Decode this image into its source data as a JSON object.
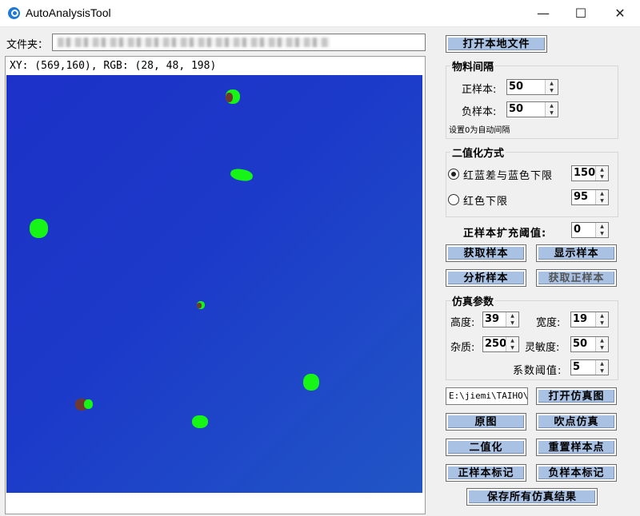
{
  "window": {
    "title": "AutoAnalysisTool",
    "minimize": "—",
    "maximize": "☐",
    "close": "✕"
  },
  "folder": {
    "label": "文件夹：",
    "value": ""
  },
  "preview": {
    "coord_readout": "XY: (569,160), RGB: (28, 48, 198)",
    "background_color": "#1c30c8",
    "blob_color": "#17f517",
    "spot_color": "#6c3a2e"
  },
  "buttons": {
    "open_local_file": "打开本地文件",
    "get_samples": "获取样本",
    "show_samples": "显示样本",
    "analyze_samples": "分析样本",
    "get_positive_samples": "获取正样本",
    "open_sim_image": "打开仿真图",
    "original_image": "原图",
    "blow_point_sim": "吹点仿真",
    "binarize": "二值化",
    "reset_sample_points": "重置样本点",
    "mark_positive": "正样本标记",
    "mark_negative": "负样本标记",
    "save_all_results": "保存所有仿真结果"
  },
  "material_interval": {
    "title": "物料间隔",
    "positive_label": "正样本:",
    "positive_value": "50",
    "negative_label": "负样本:",
    "negative_value": "50",
    "hint": "设置0为自动间隔"
  },
  "binarization": {
    "title": "二值化方式",
    "option1_label": "红蓝差与蓝色下限",
    "option1_value": "150",
    "option2_label": "红色下限",
    "option2_value": "95"
  },
  "expand_threshold": {
    "label": "正样本扩充阈值:",
    "value": "0"
  },
  "sim_params": {
    "title": "仿真参数",
    "height_label": "高度:",
    "height_value": "39",
    "width_label": "宽度:",
    "width_value": "19",
    "impurity_label": "杂质:",
    "impurity_value": "250",
    "sensitivity_label": "灵敏度:",
    "sensitivity_value": "50",
    "coef_label": "系数阈值:",
    "coef_value": "5"
  },
  "sim_path": {
    "value": "E:\\jiemi\\TAIHO\\p"
  }
}
